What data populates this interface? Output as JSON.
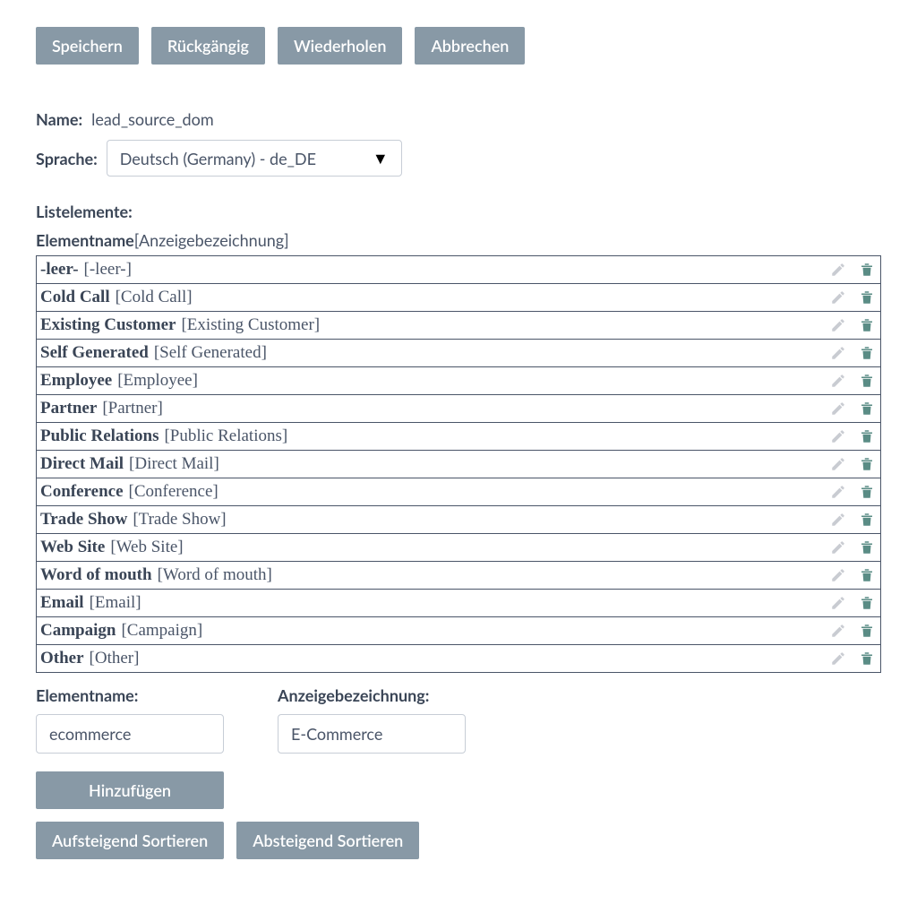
{
  "toolbar": {
    "save": "Speichern",
    "undo": "Rückgängig",
    "redo": "Wiederholen",
    "cancel": "Abbrechen"
  },
  "meta": {
    "name_label": "Name:",
    "name_value": "lead_source_dom",
    "language_label": "Sprache:",
    "language_value": "Deutsch (Germany) - de_DE"
  },
  "list": {
    "section_label": "Listelemente:",
    "header_name": "Elementname",
    "header_display": "[Anzeigebezeichnung]",
    "items": [
      {
        "name": "-leer-",
        "display": "[-leer-]"
      },
      {
        "name": "Cold Call",
        "display": "[Cold Call]"
      },
      {
        "name": "Existing Customer",
        "display": "[Existing Customer]"
      },
      {
        "name": "Self Generated",
        "display": "[Self Generated]"
      },
      {
        "name": "Employee",
        "display": "[Employee]"
      },
      {
        "name": "Partner",
        "display": "[Partner]"
      },
      {
        "name": "Public Relations",
        "display": "[Public Relations]"
      },
      {
        "name": "Direct Mail",
        "display": "[Direct Mail]"
      },
      {
        "name": "Conference",
        "display": "[Conference]"
      },
      {
        "name": "Trade Show",
        "display": "[Trade Show]"
      },
      {
        "name": "Web Site",
        "display": "[Web Site]"
      },
      {
        "name": "Word of mouth",
        "display": "[Word of mouth]"
      },
      {
        "name": "Email",
        "display": "[Email]"
      },
      {
        "name": "Campaign",
        "display": "[Campaign]"
      },
      {
        "name": "Other",
        "display": "[Other]"
      }
    ]
  },
  "add": {
    "name_label": "Elementname:",
    "name_value": "ecommerce",
    "display_label": "Anzeigebezeichnung:",
    "display_value": "E-Commerce",
    "add_button": "Hinzufügen"
  },
  "sort": {
    "asc": "Aufsteigend Sortieren",
    "desc": "Absteigend Sortieren"
  }
}
